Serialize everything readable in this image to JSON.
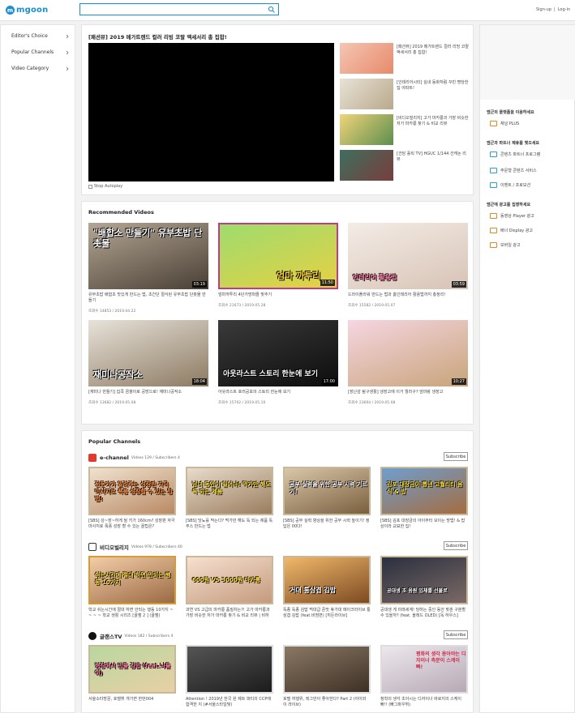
{
  "header": {
    "logo_text": "mgoon",
    "search_placeholder": "",
    "signup": "Sign-up",
    "login": "Log-in"
  },
  "leftnav": {
    "items": [
      {
        "label": "Editor's Choice"
      },
      {
        "label": "Popular Channels"
      },
      {
        "label": "Video Category"
      }
    ]
  },
  "featured": {
    "title": "[패션뷰] 2019 메가트렌드 컬러 리빙 코랄 액세서리 총 집합!",
    "autoplay_label": "Stop Autoplay",
    "side_items": [
      {
        "title": "[패션뷰] 2019 메가트렌드 컬러 리빙 코랄 액세서리 총 집합!"
      },
      {
        "title": "[인테리어시티] 실내 동화처럼 꾸민 명당한집 아파트!"
      },
      {
        "title": "[비디오빌리지] 고가 마카롱과 가장 비슷한 저가 마카롱 찾기 & 비교 리뷰"
      },
      {
        "title": "[건담 홀릭 TV] HGUC 1/144 건캐논 리뷰"
      }
    ]
  },
  "recommended": {
    "title": "Recommended Videos",
    "videos": [
      {
        "caption": "\"배합소 만들기\" 유부초밥 단촛물",
        "duration": "03:19",
        "title": "유부초밥 배합초 맛있게 만드는 법, 초간단 절식된 유부초밥 단촛물 만들기",
        "meta": "조회수 14853 / 2019.04.22"
      },
      {
        "caption": "엄마 까투리",
        "duration": "11:50",
        "title": "엄마까투리 4단가방퍼즐 맞추기",
        "meta": "조회수 21673 / 2019.05.28"
      },
      {
        "caption": "인테리어 활용법",
        "duration": "03:59",
        "title": "드라이플라워 만드는 법과 홈인테리어 활용법까지 총정리!",
        "meta": "조회수 15582 / 2019.05.07"
      },
      {
        "caption": "재미나공작소",
        "duration": "18:04",
        "title": "[재미나 만들기] 집콕 곰팡이로 공방으로! 재미나공작소",
        "meta": "조회수 13682 / 2019.05.08"
      },
      {
        "caption": "아웃라스트 스토리 한눈에 보기",
        "duration": "17:00",
        "title": "아웃라스트 호러공포의 스토리 한눈에 보기",
        "meta": "조회수 15702 / 2019.05.10"
      },
      {
        "caption": "",
        "duration": "10:27",
        "title": "[장난감 탐구생활] 냉장고에 이거 뭘라구? 엄마랑 냉장고",
        "meta": "조회수 23604 / 2019.05.08"
      }
    ]
  },
  "popular": {
    "title": "Popular Channels",
    "subscribe_label": "Subscribe",
    "channels": [
      {
        "name": "e-channel",
        "meta": "Videos 129 / Subscribers 4",
        "videos": [
          {
            "caption": "전문가가 알려주는 성장판 자극 마사지로 폭풍 성장할 수 있는 방법!",
            "title": "[SBS] 성~장~하게 될 키가 160cm? 성장판 자극 마사지로 폭풍 성장 할 수 있는 꿀팁은?"
          },
          {
            "caption": "남녀 동안이 일어나! 먹가만 해도 독 되는 제품",
            "title": "[SBS] 당뇨를 막는다? 먹가만 해도 독 되는 제품 독 주스 만드는 법"
          },
          {
            "caption": "공부 실력을 위한 공부 시력 기르기!",
            "title": "[SBS] 공부 실력 향상을 위한 공부 시력 높이기! 정답은 00다!"
          },
          {
            "caption": "김포 대장금이 뽑낸 고퀄리티 음식 & 밥",
            "title": "[SBS] 김포 대장금의 아이부터 모이는 방법! & 밥상이라 교묘한 집!"
          }
        ]
      },
      {
        "name": "비디오빌리지",
        "meta": "Videos 978 / Subscribers 40",
        "videos": [
          {
            "caption": "쉬는시간에 절대 하면 안되는 행동 10가지",
            "title": "학교 쉬는시간에 절대 하면 안되는 행동 10가지 ~ ~ ~ ~ 학교 생활 시리즈 [꿀잼 2 ] (꿀잼)"
          },
          {
            "caption": "600원 VS 3000원 마카롱",
            "title": "과연 VS 고급의 마카롱 품질차는?! 고가 마카롱과 가장 비슷한 저가 마카롱 찾기 & 비교 리뷰 | 비하"
          },
          {
            "caption": "거대 통삼겹 김밥",
            "title": "독종 독종 김밥 먹대급 준맛 휴가대 메이크라이브 통삼겹 김밥 (feat.비빔면) [히든라이브]"
          },
          {
            "caption": "공대생 초 음원 입체를 선물로",
            "title": "공대생 게 미래세계! 당하는 중인 동안 맞춘 구분할 수 있을까? (feat. 올레드 OLED) [독 하우스]"
          }
        ]
      },
      {
        "name": "글랜스TV",
        "meta": "Videos 182 / Subscribers 4",
        "videos": [
          {
            "caption": "현장에서 만들 김밥 (feat.나들이)",
            "title": "서울소타방문, 호텔뷔 개기면 한번004"
          },
          {
            "caption": "",
            "title": "Attention ! 2019년 한국 원 제트 파티의 CCP에 합격한 지 (#서울스타일빛)"
          },
          {
            "caption": "",
            "title": "호텔 여행위, 레그만이 좋아한다? Part 2 (아이와 이 라이브)"
          },
          {
            "caption": "평화의 생각 용아야는 디자이너 측분이 스케이 빠!",
            "title": "청학의 생각 초아시는 디자이너 바로지의 스케이 빠!! (빠그파우뷔)"
          }
        ]
      }
    ]
  },
  "rightpanel": {
    "sections": [
      {
        "heading": "엠군의 플랫폼을 이용하세요",
        "items": [
          "채널 PLUS"
        ]
      },
      {
        "heading": "엠군과 파트너 제휴를 맺으세요",
        "items": [
          "콘텐츠 파트너 프로그램",
          "주문형 콘텐츠 서비스",
          "이벤트 / 프로모션"
        ]
      },
      {
        "heading": "엠군에 광고를 집행하세요",
        "items": [
          "동영상 Player 광고",
          "배너 Display 광고",
          "모바일 광고"
        ]
      }
    ]
  }
}
